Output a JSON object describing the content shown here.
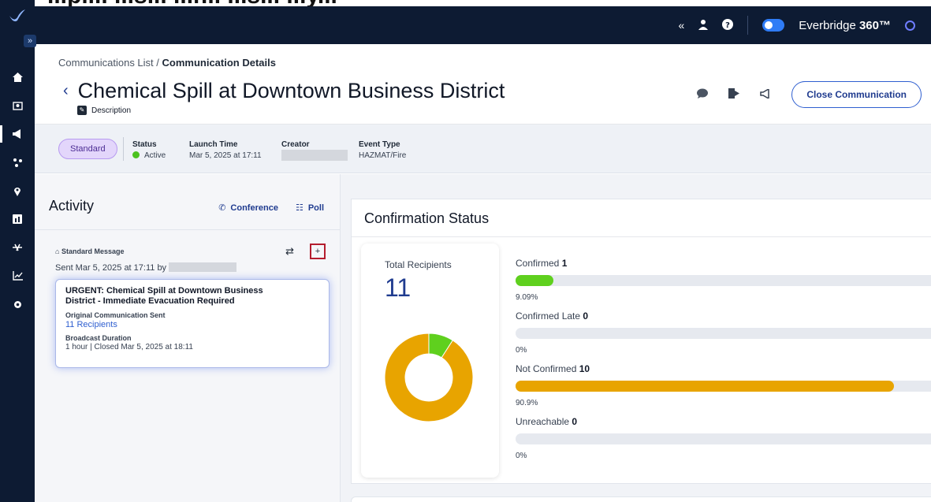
{
  "top_caption": "...pl... ...s... ...r... ...s... ...y...",
  "topbar": {
    "brand_name": "Everbridge",
    "brand_suffix": "360™",
    "icons": [
      "collapse-icon",
      "user-icon",
      "help-icon",
      "toggle",
      "brand-circle-icon"
    ]
  },
  "sidebar": {
    "expand_label": "»",
    "items": [
      "home-icon",
      "contacts-icon",
      "communications-icon",
      "incidents-icon",
      "location-icon",
      "dashboard-icon",
      "integration-icon",
      "analytics-icon",
      "settings-icon"
    ]
  },
  "header": {
    "breadcrumb_parent": "Communications List",
    "breadcrumb_sep": " / ",
    "breadcrumb_current": "Communication Details",
    "back_glyph": "‹",
    "title": "Chemical Spill at Downtown Business District",
    "description_label": "Description",
    "close_button": "Close Communication"
  },
  "info_bar": {
    "type_pill": "Standard",
    "status_label": "Status",
    "status_value": "Active",
    "launch_label": "Launch Time",
    "launch_value": "Mar 5, 2025 at 17:11",
    "creator_label": "Creator",
    "event_type_label": "Event Type",
    "event_type_value": "HAZMAT/Fire"
  },
  "activity": {
    "title": "Activity",
    "conference_label": "Conference",
    "poll_label": "Poll",
    "message_type": "Standard Message",
    "sent_text": "Sent Mar 5, 2025 at 17:11 by",
    "card_title": "URGENT: Chemical Spill at Downtown Business District - Immediate Evacuation Required",
    "original_label": "Original Communication Sent",
    "recipients_link": "11 Recipients",
    "duration_label": "Broadcast Duration",
    "duration_value": "1 hour | Closed Mar 5, 2025 at 18:11"
  },
  "confirmation": {
    "title": "Confirmation Status",
    "total_label": "Total Recipients",
    "total_value": "11",
    "rows": [
      {
        "label": "Confirmed",
        "count": "1",
        "pct": "9.09%",
        "fraction": 0.0909,
        "color": "#5fd01e"
      },
      {
        "label": "Confirmed Late",
        "count": "0",
        "pct": "0%",
        "fraction": 0,
        "color": "#5fd01e"
      },
      {
        "label": "Not Confirmed",
        "count": "10",
        "pct": "90.9%",
        "fraction": 0.909,
        "color": "#e8a400"
      },
      {
        "label": "Unreachable",
        "count": "0",
        "pct": "0%",
        "fraction": 0,
        "color": "#9aa3b0"
      }
    ]
  },
  "colors": {
    "nav_bg": "#0d1b33",
    "accent_blue": "#1f3b8f",
    "confirmed_green": "#5fd01e",
    "not_confirmed_orange": "#e8a400",
    "pill_purple": "#e3d6fb"
  }
}
